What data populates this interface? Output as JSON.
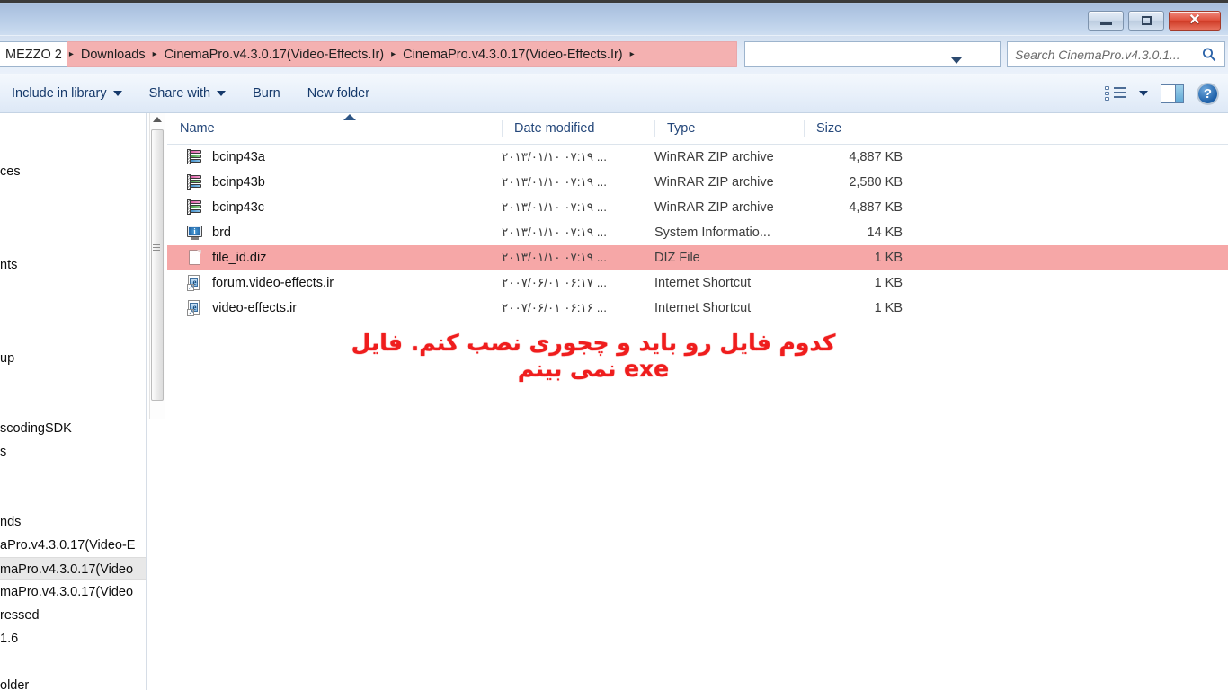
{
  "window": {
    "buttons": {
      "minimize": "Minimize",
      "maximize": "Maximize",
      "close": "Close"
    }
  },
  "addressbar": {
    "crumbs": [
      "MEZZO 2",
      "Downloads",
      "CinemaPro.v4.3.0.17(Video-Effects.Ir)",
      "CinemaPro.v4.3.0.17(Video-Effects.Ir)"
    ],
    "separator": "▸",
    "dropdown_icon": "chevron-down",
    "refresh_icon": "↻",
    "highlight_color": "#f2a6a6"
  },
  "search": {
    "placeholder": "Search CinemaPro.v4.3.0.1...",
    "icon": "🔍"
  },
  "toolbar": {
    "items": [
      {
        "label": "Include in library",
        "has_caret": true
      },
      {
        "label": "Share with",
        "has_caret": true
      },
      {
        "label": "Burn",
        "has_caret": false
      },
      {
        "label": "New folder",
        "has_caret": false
      }
    ],
    "right_icons": [
      "views-icon",
      "views-caret-icon",
      "preview-pane-icon",
      "help-icon"
    ],
    "help_glyph": "?"
  },
  "navpane": {
    "items": [
      {
        "label": "",
        "selected": false
      },
      {
        "label": "",
        "selected": false
      },
      {
        "label": "ces",
        "selected": false
      },
      {
        "label": "",
        "selected": false
      },
      {
        "label": "",
        "selected": false
      },
      {
        "label": "",
        "selected": false
      },
      {
        "label": "nts",
        "selected": false
      },
      {
        "label": "",
        "selected": false
      },
      {
        "label": "",
        "selected": false
      },
      {
        "label": "",
        "selected": false
      },
      {
        "label": "up",
        "selected": false
      },
      {
        "label": "",
        "selected": false
      },
      {
        "label": "",
        "selected": false
      },
      {
        "label": "scodingSDK",
        "selected": false
      },
      {
        "label": "s",
        "selected": false
      },
      {
        "label": "",
        "selected": false
      },
      {
        "label": "",
        "selected": false
      },
      {
        "label": "nds",
        "selected": false
      },
      {
        "label": "aPro.v4.3.0.17(Video-E",
        "selected": false
      },
      {
        "label": "maPro.v4.3.0.17(Video",
        "selected": true
      },
      {
        "label": "maPro.v4.3.0.17(Video",
        "selected": false
      },
      {
        "label": "ressed",
        "selected": false
      },
      {
        "label": "1.6",
        "selected": false
      },
      {
        "label": "",
        "selected": false
      },
      {
        "label": "older",
        "selected": false
      }
    ]
  },
  "filelist": {
    "columns": [
      "Name",
      "Date modified",
      "Type",
      "Size"
    ],
    "sort_column": "Name",
    "sort_direction": "ascending",
    "rows": [
      {
        "name": "bcinp43a",
        "date": "۲۰۱۳/۰۱/۱۰ ۰۷:۱۹ ...",
        "type": "WinRAR ZIP archive",
        "size": "4,887 KB",
        "icon": "winrar-archive-icon",
        "selected": false
      },
      {
        "name": "bcinp43b",
        "date": "۲۰۱۳/۰۱/۱۰ ۰۷:۱۹ ...",
        "type": "WinRAR ZIP archive",
        "size": "2,580 KB",
        "icon": "winrar-archive-icon",
        "selected": false
      },
      {
        "name": "bcinp43c",
        "date": "۲۰۱۳/۰۱/۱۰ ۰۷:۱۹ ...",
        "type": "WinRAR ZIP archive",
        "size": "4,887 KB",
        "icon": "winrar-archive-icon",
        "selected": false
      },
      {
        "name": "brd",
        "date": "۲۰۱۳/۰۱/۱۰ ۰۷:۱۹ ...",
        "type": "System Informatio...",
        "size": "14 KB",
        "icon": "system-information-icon",
        "selected": false
      },
      {
        "name": "file_id.diz",
        "date": "۲۰۱۳/۰۱/۱۰ ۰۷:۱۹ ...",
        "type": "DIZ File",
        "size": "1 KB",
        "icon": "document-icon",
        "selected": true
      },
      {
        "name": "forum.video-effects.ir",
        "date": "۲۰۰۷/۰۶/۰۱ ۰۶:۱۷ ...",
        "type": "Internet Shortcut",
        "size": "1 KB",
        "icon": "internet-shortcut-icon",
        "selected": false
      },
      {
        "name": "video-effects.ir",
        "date": "۲۰۰۷/۰۶/۰۱ ۰۶:۱۶ ...",
        "type": "Internet Shortcut",
        "size": "1 KB",
        "icon": "internet-shortcut-icon",
        "selected": false
      }
    ],
    "selection_color": "#f6a7a7"
  },
  "annotation": {
    "text": "کدوم فایل رو باید و چجوری نصب کنم. فایل exe نمی بینم",
    "color": "#ef1d1d"
  }
}
